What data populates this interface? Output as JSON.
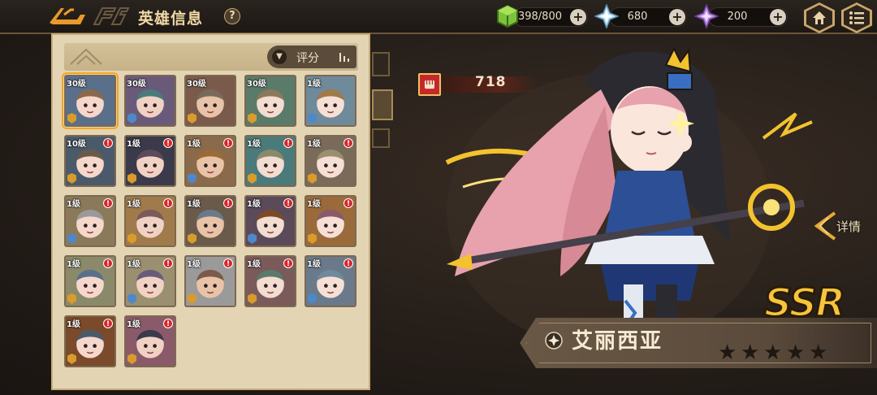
{
  "header": {
    "title": "英雄信息",
    "help_label": "?"
  },
  "resources": [
    {
      "name": "energy",
      "value": "398/800",
      "plus": "+"
    },
    {
      "name": "crystal",
      "value": "680",
      "plus": "+"
    },
    {
      "name": "gem",
      "value": "200",
      "plus": "+"
    }
  ],
  "hero_list": {
    "sort_label": "评分",
    "heroes": [
      {
        "level": "30级",
        "alert": false,
        "selected": true
      },
      {
        "level": "30级",
        "alert": false,
        "selected": false
      },
      {
        "level": "30级",
        "alert": false,
        "selected": false
      },
      {
        "level": "30级",
        "alert": false,
        "selected": false
      },
      {
        "level": "1级",
        "alert": false,
        "selected": false
      },
      {
        "level": "10级",
        "alert": true,
        "selected": false
      },
      {
        "level": "1级",
        "alert": true,
        "selected": false
      },
      {
        "level": "1级",
        "alert": true,
        "selected": false
      },
      {
        "level": "1级",
        "alert": true,
        "selected": false
      },
      {
        "level": "1级",
        "alert": true,
        "selected": false
      },
      {
        "level": "1级",
        "alert": true,
        "selected": false
      },
      {
        "level": "1级",
        "alert": true,
        "selected": false
      },
      {
        "level": "1级",
        "alert": true,
        "selected": false
      },
      {
        "level": "1级",
        "alert": true,
        "selected": false
      },
      {
        "level": "1级",
        "alert": true,
        "selected": false
      },
      {
        "level": "1级",
        "alert": true,
        "selected": false
      },
      {
        "level": "1级",
        "alert": true,
        "selected": false
      },
      {
        "level": "1级",
        "alert": true,
        "selected": false
      },
      {
        "level": "1级",
        "alert": true,
        "selected": false
      },
      {
        "level": "1级",
        "alert": true,
        "selected": false
      },
      {
        "level": "1级",
        "alert": true,
        "selected": false
      },
      {
        "level": "1级",
        "alert": true,
        "selected": false
      }
    ]
  },
  "hero_detail": {
    "power": "718",
    "detail_label": "详情",
    "rarity": "SSR",
    "name": "艾丽西亚",
    "stars": 5
  },
  "colors": {
    "accent_gold": "#f6c53a",
    "alert_red": "#d6262a",
    "panel_bg": "#e3d5b4"
  }
}
